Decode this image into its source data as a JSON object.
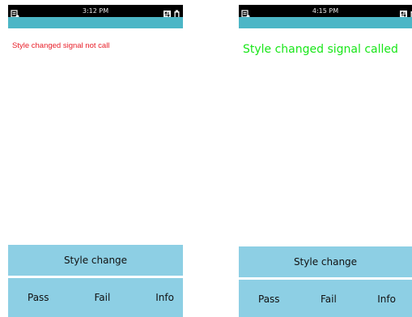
{
  "screens": [
    {
      "status_time": "3:12 PM",
      "message": "Style changed signal not call",
      "style_button_label": "Style change",
      "pass_label": "Pass",
      "fail_label": "Fail",
      "info_label": "Info"
    },
    {
      "status_time": "4:15 PM",
      "message": "Style changed signal called",
      "style_button_label": "Style change",
      "pass_label": "Pass",
      "fail_label": "Fail",
      "info_label": "Info"
    }
  ],
  "icons": {
    "status_left": "app-notification-icon",
    "status_right": [
      "data-transfer-icon",
      "battery-icon"
    ]
  },
  "colors": {
    "status_bar": "#000000",
    "title_bar": "#4cb6c6",
    "button_bg": "#8dcfe4",
    "fail_message": "#e8202a",
    "pass_message": "#19e619"
  }
}
